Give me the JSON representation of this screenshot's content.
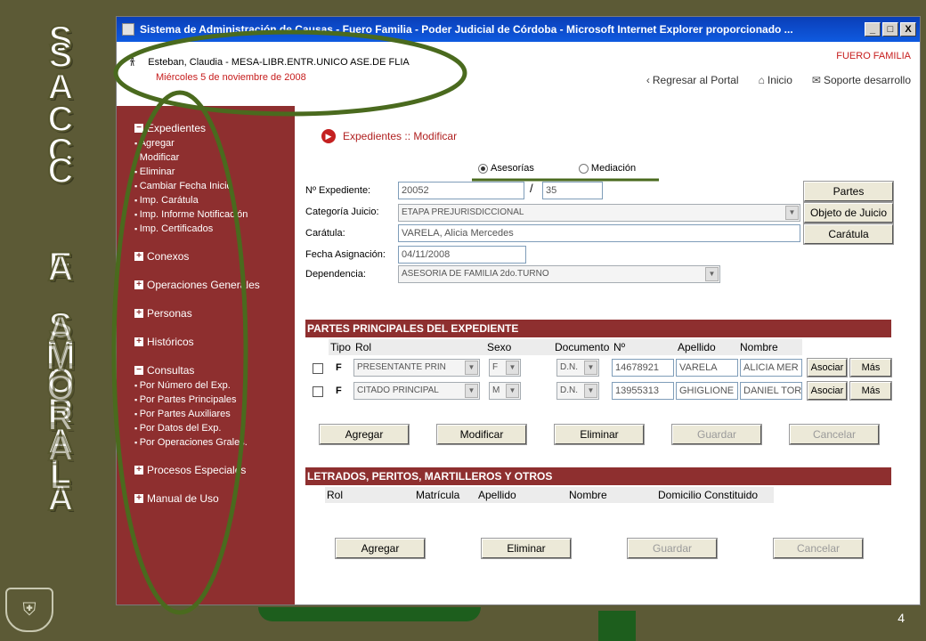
{
  "slide": {
    "letters_col1": [
      "S",
      "A",
      "C",
      "C"
    ],
    "letters_col2": [
      "E",
      "A"
    ],
    "letters_col3": [
      "S",
      "M",
      "O",
      "R",
      "A",
      "L",
      "A"
    ],
    "letters_col4": [
      "A",
      "M",
      "O",
      "R",
      "A",
      "L"
    ],
    "page_number": "4"
  },
  "window": {
    "title": "Sistema de Administración de Causas - Fuero Familia - Poder Judicial de Córdoba - Microsoft Internet Explorer proporcionado ...",
    "minimize": "_",
    "maximize": "□",
    "close": "X"
  },
  "header": {
    "user": "Esteban, Claudia - MESA-LIBR.ENTR.UNICO ASE.DE FLIA",
    "date": "Miércoles 5 de noviembre de 2008",
    "fuero": "FUERO FAMILIA",
    "links": [
      "Regresar al Portal",
      "Inicio",
      "Soporte desarrollo"
    ]
  },
  "menu": {
    "expedientes": {
      "label": "Expedientes",
      "items": [
        "Agregar",
        "Modificar",
        "Eliminar",
        "Cambiar Fecha Inicio",
        "Imp. Carátula",
        "Imp. Informe Notificación",
        "Imp. Certificados"
      ]
    },
    "conexos": "Conexos",
    "operaciones": "Operaciones Generales",
    "personas": "Personas",
    "historicos": "Históricos",
    "consultas": {
      "label": "Consultas",
      "items": [
        "Por Número del Exp.",
        "Por Partes Principales",
        "Por Partes Auxiliares",
        "Por Datos del Exp.",
        "Por Operaciones Grales."
      ]
    },
    "procesos": "Procesos Especiales",
    "manual": "Manual de Uso"
  },
  "form": {
    "breadcrumb": "Expedientes :: Modificar",
    "radio_asesorias": "Asesorías",
    "radio_mediacion": "Mediación",
    "nro_label": "Nº Expediente:",
    "nro_value": "20052",
    "nro_slash": "/",
    "nro_year": "35",
    "categoria_label": "Categoría Juicio:",
    "categoria_value": "ETAPA PREJURISDICCIONAL",
    "caratula_label": "Carátula:",
    "caratula_value": "VARELA, Alicia Mercedes",
    "fecha_label": "Fecha Asignación:",
    "fecha_value": "04/11/2008",
    "dependencia_label": "Dependencia:",
    "dependencia_value": "ASESORIA DE FAMILIA 2do.TURNO",
    "btn_partes": "Partes",
    "btn_objeto": "Objeto de Juicio",
    "btn_caratula": "Carátula"
  },
  "partes": {
    "title": "PARTES PRINCIPALES DEL EXPEDIENTE",
    "headers": [
      "Tipo",
      "Rol",
      "Sexo",
      "Documento",
      "Nº",
      "Apellido",
      "Nombre"
    ],
    "rows": [
      {
        "tipo": "F",
        "rol": "PRESENTANTE PRIN",
        "sexo": "F",
        "doc": "D.N.",
        "nro": "14678921",
        "apellido": "VARELA",
        "nombre": "ALICIA MER",
        "asociar": "Asociar",
        "mas": "Más"
      },
      {
        "tipo": "F",
        "rol": "CITADO PRINCIPAL",
        "sexo": "M",
        "doc": "D.N.",
        "nro": "13955313",
        "apellido": "GHIGLIONE",
        "nombre": "DANIEL TOR",
        "asociar": "Asociar",
        "mas": "Más"
      }
    ],
    "buttons": [
      "Agregar",
      "Modificar",
      "Eliminar",
      "Guardar",
      "Cancelar"
    ]
  },
  "letrados": {
    "title": "LETRADOS, PERITOS, MARTILLEROS Y OTROS",
    "headers": [
      "Rol",
      "Matrícula",
      "Apellido",
      "Nombre",
      "Domicilio Constituido"
    ],
    "buttons": [
      "Agregar",
      "Eliminar",
      "Guardar",
      "Cancelar"
    ]
  },
  "colors": {
    "menu_bg": "#8e2f2f",
    "slide_bg": "#5c5a36",
    "annotation": "#4a6a1e"
  }
}
